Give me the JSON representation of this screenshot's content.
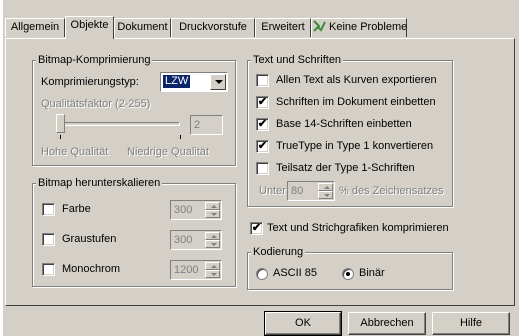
{
  "tabs": [
    "Allgemein",
    "Objekte",
    "Dokument",
    "Druckvorstufe",
    "Erweitert",
    "Keine Probleme"
  ],
  "compress": {
    "title": "Bitmap-Komprimierung",
    "type_label": "Komprimierungstyp:",
    "type_value": "LZW",
    "quality_label": "Qualitätsfaktor (2-255)",
    "quality_value": "2",
    "high_label": "Hohe Qualität",
    "low_label": "Niedrige Qualität"
  },
  "downsample": {
    "title": "Bitmap herunterskalieren",
    "items": [
      {
        "label": "Farbe",
        "value": "300",
        "checked": false
      },
      {
        "label": "Graustufen",
        "value": "300",
        "checked": false
      },
      {
        "label": "Monochrom",
        "value": "1200",
        "checked": false
      }
    ]
  },
  "fonts": {
    "title": "Text und Schriften",
    "items": [
      {
        "label": "Allen Text als Kurven exportieren",
        "checked": false
      },
      {
        "label": "Schriften im Dokument einbetten",
        "checked": true
      },
      {
        "label": "Base 14-Schriften einbetten",
        "checked": true
      },
      {
        "label": "TrueType in Type 1 konvertieren",
        "checked": true
      },
      {
        "label": "Teilsatz der Type 1-Schriften",
        "checked": false
      }
    ],
    "under_label": "Unter",
    "under_value": "80",
    "percent_label": "% des Zeichensatzes"
  },
  "compress_text": {
    "label": "Text und Strichgrafiken komprimieren",
    "checked": true
  },
  "encoding": {
    "title": "Kodierung",
    "options": [
      {
        "label": "ASCII 85",
        "selected": false
      },
      {
        "label": "Binär",
        "selected": true
      }
    ]
  },
  "buttons": {
    "ok": "OK",
    "cancel": "Abbrechen",
    "help": "Hilfe"
  },
  "colors": {
    "face": "#d4d0c8",
    "highlight": "#0a246a",
    "icon_green": "#3c8c3c"
  }
}
